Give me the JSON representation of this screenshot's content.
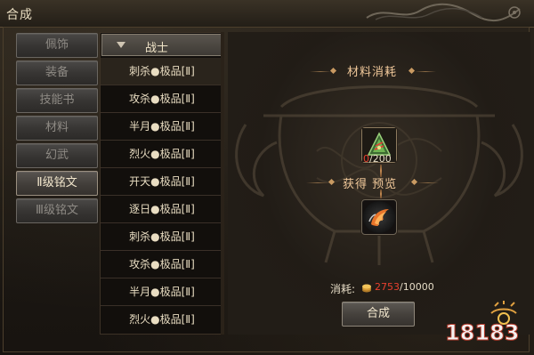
{
  "window": {
    "title": "合成"
  },
  "tabs": [
    {
      "label": "佩饰",
      "active": false
    },
    {
      "label": "装备",
      "active": false
    },
    {
      "label": "技能书",
      "active": false
    },
    {
      "label": "材料",
      "active": false
    },
    {
      "label": "幻武",
      "active": false
    },
    {
      "label": "Ⅱ级铭文",
      "active": true
    },
    {
      "label": "Ⅲ级铭文",
      "active": false
    }
  ],
  "list": {
    "header": "战士",
    "items": [
      "刺杀●极品[Ⅱ]",
      "攻杀●极品[Ⅱ]",
      "半月●极品[Ⅱ]",
      "烈火●极品[Ⅱ]",
      "开天●极品[Ⅱ]",
      "逐日●极品[Ⅱ]",
      "刺杀●极品[Ⅱ]",
      "攻杀●极品[Ⅱ]",
      "半月●极品[Ⅱ]",
      "烈火●极品[Ⅱ]"
    ],
    "selected_index": 0
  },
  "materials": {
    "title": "材料消耗",
    "owned": "0",
    "required": "/200",
    "icon": "rune-material-icon"
  },
  "preview": {
    "title": "获得 预览",
    "icon": "flame-skill-icon"
  },
  "cost": {
    "label": "消耗:",
    "current": "2753",
    "total": "/10000",
    "icon": "gold-coin-icon"
  },
  "craft_button": "合成",
  "watermark": "18183",
  "colors": {
    "insufficient": "#e8402f",
    "section_title": "#f0c89a",
    "text": "#e6dcc6"
  }
}
